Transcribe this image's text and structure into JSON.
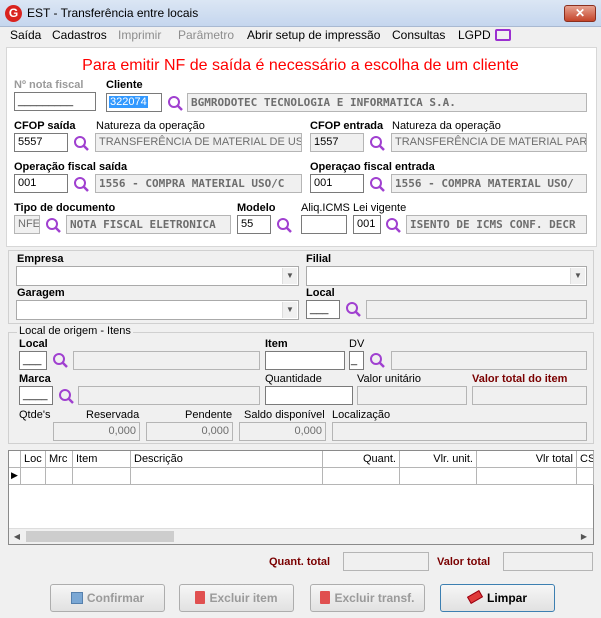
{
  "window": {
    "title": "EST - Transferência entre locais",
    "app_icon": "G",
    "close": "✕"
  },
  "menu": [
    {
      "label": "Saída",
      "disabled": false
    },
    {
      "label": "Cadastros",
      "disabled": false
    },
    {
      "label": "Imprimir",
      "disabled": true
    },
    {
      "label": "Parâmetro",
      "disabled": true
    },
    {
      "label": "Abrir setup de impressão",
      "disabled": false
    },
    {
      "label": "Consultas",
      "disabled": false
    },
    {
      "label": "LGPD",
      "disabled": false
    }
  ],
  "warning": "Para emitir NF de saída é necessário a escolha de um cliente",
  "header": {
    "nota_fiscal_label": "Nº nota fiscal",
    "nota_fiscal_value": "_________",
    "cliente_label": "Cliente",
    "cliente_code": "322074",
    "cliente_name": "BGMRODOTEC TECNOLOGIA E INFORMATICA S.A.",
    "cfop_saida_label": "CFOP saída",
    "cfop_saida_value": "5557",
    "natureza_label": "Natureza da operação",
    "natureza_saida_value": "TRANSFERÊNCIA DE MATERIAL DE USO",
    "cfop_entrada_label": "CFOP entrada",
    "cfop_entrada_value": "1557",
    "natureza_entrada_value": "TRANSFERÊNCIA DE MATERIAL PARA",
    "op_fiscal_saida_label": "Operação fiscal saída",
    "op_fiscal_saida_code": "001",
    "op_fiscal_saida_desc": "1556 - COMPRA MATERIAL USO/C",
    "op_fiscal_entrada_label": "Operaçao fiscal entrada",
    "op_fiscal_entrada_code": "001",
    "op_fiscal_entrada_desc": "1556 - COMPRA MATERIAL USO/",
    "tipo_doc_label": "Tipo de documento",
    "tipo_doc_code": "NFE",
    "tipo_doc_desc": "NOTA FISCAL ELETRONICA",
    "modelo_label": "Modelo",
    "modelo_value": "55",
    "aliq_label": "Aliq.ICMS",
    "aliq_value": "",
    "lei_label": "Lei vigente",
    "lei_code": "001",
    "lei_desc": "ISENTO DE ICMS CONF. DECR"
  },
  "destino": {
    "empresa_label": "Empresa",
    "filial_label": "Filial",
    "garagem_label": "Garagem",
    "local_label": "Local",
    "local_value": "___"
  },
  "origem": {
    "group_label": "Local de origem - Itens",
    "local_label": "Local",
    "local_value": "___",
    "item_label": "Item",
    "dv_label": "DV",
    "dv_value": "_",
    "marca_label": "Marca",
    "marca_value": "____",
    "quantidade_label": "Quantidade",
    "valor_unitario_label": "Valor unitário",
    "valor_total_label": "Valor total do item",
    "qtdes_label": "Qtde's",
    "reservada_label": "Reservada",
    "reservada_value": "0,000",
    "pendente_label": "Pendente",
    "pendente_value": "0,000",
    "saldo_label": "Saldo disponível",
    "saldo_value": "0,000",
    "localizacao_label": "Localização"
  },
  "grid": {
    "columns": [
      "Loc",
      "Mrc",
      "Item",
      "Descrição",
      "Quant.",
      "Vlr. unit.",
      "Vlr total",
      "CS"
    ]
  },
  "totals": {
    "quant_label": "Quant. total",
    "valor_label": "Valor total"
  },
  "buttons": {
    "confirmar": "Confirmar",
    "excluir_item": "Excluir item",
    "excluir_transf": "Excluir transf.",
    "limpar": "Limpar"
  },
  "colors": {
    "warning": "#ff0000",
    "magnifier": "#a040d0",
    "accent_label": "#7a0000"
  }
}
